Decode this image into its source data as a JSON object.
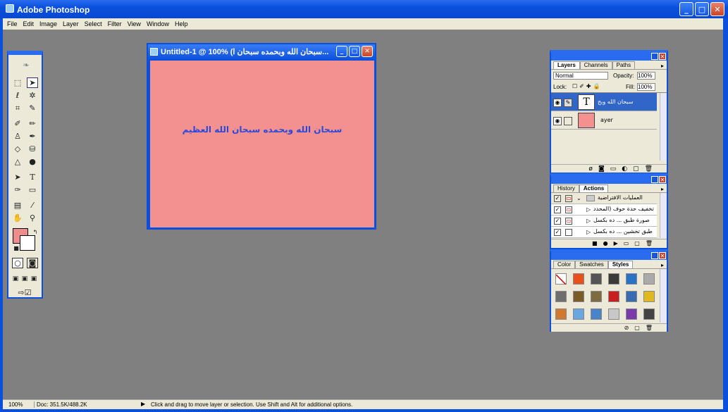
{
  "app": {
    "title": "Adobe Photoshop"
  },
  "menu": [
    "File",
    "Edit",
    "Image",
    "Layer",
    "Select",
    "Filter",
    "View",
    "Window",
    "Help"
  ],
  "document": {
    "title": "Untitled-1 @ 100% (سبحان الله وبحمده سبحان ا...",
    "canvas_text": "سبحان الله وبحمده سبحان الله العظيم",
    "canvas_color": "#f39191"
  },
  "layers_panel": {
    "tabs": [
      "Layers",
      "Channels",
      "Paths"
    ],
    "active_tab": "Layers",
    "blend_mode": "Normal",
    "opacity_label": "Opacity:",
    "opacity_value": "100%",
    "lock_label": "Lock:",
    "fill_label": "Fill:",
    "fill_value": "100%",
    "layers": [
      {
        "name": "سبحان الله وبح",
        "thumb": "T",
        "selected": true
      },
      {
        "name": "ayer",
        "thumb": "",
        "selected": false
      }
    ]
  },
  "actions_panel": {
    "tabs": [
      "History",
      "Actions"
    ],
    "active_tab": "Actions",
    "rows": [
      "العمليات الافتراضية",
      "تخفيف حدة حوف (المحدد",
      "صورة طبق ... ده بكسل",
      "طبق تخشين ... ده بكسل"
    ]
  },
  "styles_panel": {
    "tabs": [
      "Color",
      "Swatches",
      "Styles"
    ],
    "active_tab": "Styles",
    "swatches": [
      "#ffffff",
      "#e8501c",
      "#555555",
      "#3a3a3a",
      "#2a72c8",
      "#aaaaaa",
      "#6e6e6e",
      "#7a5c28",
      "#7e6b40",
      "#c82020",
      "#3a6ab0",
      "#e0b820",
      "#d07a30",
      "#6aa6e0",
      "#4a84c8",
      "#c8c8c8",
      "#7a3aa8",
      "#444444"
    ]
  },
  "toolbox": {
    "fg_color": "#f08c8c",
    "bg_color": "#ffffff"
  },
  "status": {
    "zoom": "100%",
    "doc_size": "Doc: 351.5K/488.2K",
    "hint": "Click and drag to move layer or selection. Use Shift and Alt for additional options."
  }
}
